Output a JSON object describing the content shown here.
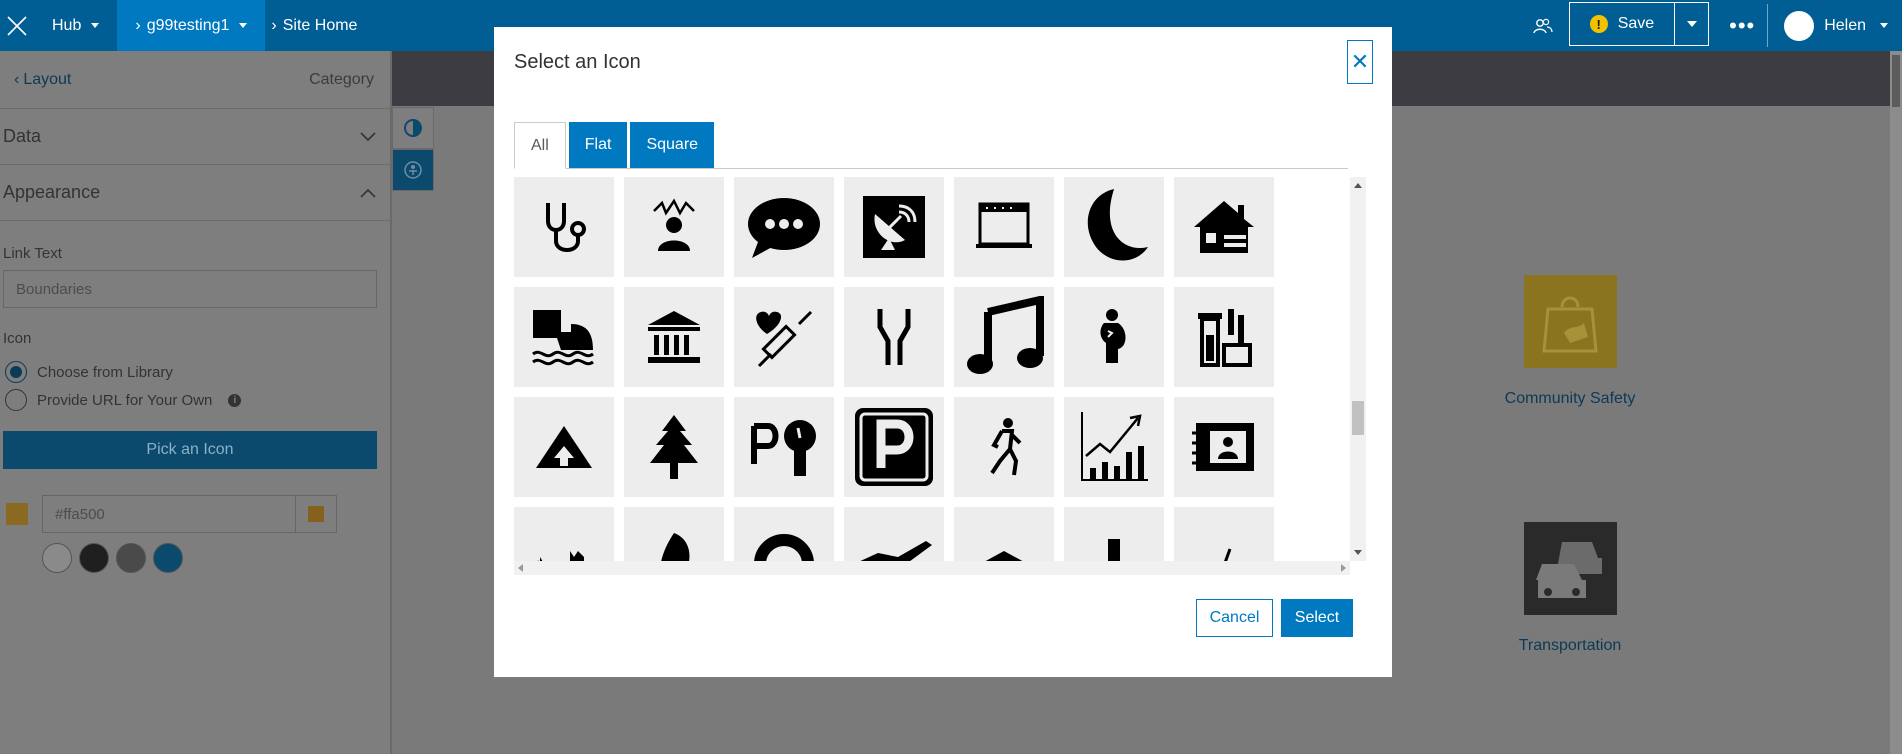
{
  "topbar": {
    "app_label": "Hub",
    "site_label": "g99testing1",
    "page_label": "Site Home",
    "save_label": "Save",
    "warning_glyph": "!",
    "more_glyph": "•••",
    "user_name": "Helen"
  },
  "panel": {
    "back_label": "Layout",
    "header_right": "Category",
    "data_section": "Data",
    "appearance_section": "Appearance",
    "link_text_label": "Link Text",
    "link_text_value": "Boundaries",
    "icon_label": "Icon",
    "radio_library": "Choose from Library",
    "radio_url": "Provide URL for Your Own",
    "info_glyph": "i",
    "pick_button": "Pick an Icon",
    "color_value": "#ffa500",
    "preset_colors": [
      "#ffffff",
      "#323232",
      "#595959",
      "#0079c1"
    ]
  },
  "background": {
    "cards": [
      {
        "label": "Community Safety",
        "icon": "shopping-bag-map-icon",
        "tile_color": "#ffd21a"
      },
      {
        "label": "Transportation",
        "icon": "traffic-cars-icon",
        "tile_color": "#151515"
      }
    ]
  },
  "modal": {
    "title": "Select an Icon",
    "close_glyph": "✕",
    "tabs": [
      {
        "label": "All",
        "selected": true
      },
      {
        "label": "Flat",
        "selected": false
      },
      {
        "label": "Square",
        "selected": false
      }
    ],
    "icons": [
      "stethoscope-icon",
      "alarm-person-icon",
      "chat-bubble-icon",
      "satellite-dish-icon",
      "oven-icon",
      "moon-icon",
      "house-icon",
      "flood-icon",
      "museum-icon",
      "vaccine-icon",
      "road-narrows-icon",
      "music-note-icon",
      "pregnancy-icon",
      "laboratory-icon",
      "camping-icon",
      "pine-tree-icon",
      "parking-meter-icon",
      "parking-icon",
      "walking-person-icon",
      "growth-chart-icon",
      "contact-card-icon",
      "cat-icon",
      "leaf-icon",
      "ring-icon",
      "airplane-icon",
      "roof-icon",
      "pedestal-icon",
      "slash-icon"
    ],
    "cancel_label": "Cancel",
    "select_label": "Select"
  }
}
